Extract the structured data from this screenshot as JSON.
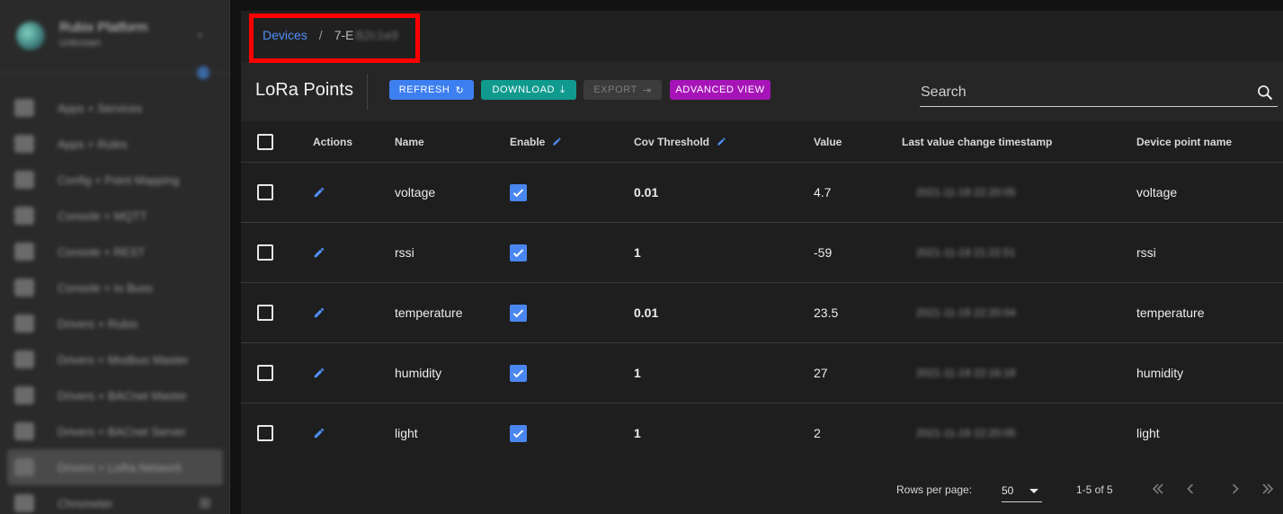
{
  "sidebar": {
    "brand_title": "Rubix Platform",
    "brand_sub": "Unknown",
    "items": [
      {
        "label": "Apps + Services"
      },
      {
        "label": "Apps + Rules"
      },
      {
        "label": "Config + Point Mapping"
      },
      {
        "label": "Console + MQTT"
      },
      {
        "label": "Console + REST"
      },
      {
        "label": "Console + Io Buss"
      },
      {
        "label": "Drivers + Rubix"
      },
      {
        "label": "Drivers + Modbus Master"
      },
      {
        "label": "Drivers + BACnet Master"
      },
      {
        "label": "Drivers + BACnet Server"
      },
      {
        "label": "Drivers + LoRa Network"
      },
      {
        "label": "Chrometer"
      }
    ]
  },
  "breadcrumb": {
    "link": "Devices",
    "separator": "/",
    "current": "7-E",
    "current_obscured": "B2c1e9"
  },
  "toolbar": {
    "title": "LoRa Points",
    "refresh": "REFRESH",
    "download": "DOWNLOAD",
    "export": "EXPORT",
    "advanced": "ADVANCED VIEW",
    "search_placeholder": "Search"
  },
  "table": {
    "headers": {
      "actions": "Actions",
      "name": "Name",
      "enable": "Enable",
      "cov": "Cov Threshold",
      "value": "Value",
      "timestamp": "Last value change timestamp",
      "device_point_name": "Device point name"
    },
    "rows": [
      {
        "name": "voltage",
        "enabled": true,
        "cov": "0.01",
        "value": "4.7",
        "timestamp": "2021-11-19 22:20:05",
        "dpn": "voltage"
      },
      {
        "name": "rssi",
        "enabled": true,
        "cov": "1",
        "value": "-59",
        "timestamp": "2021-11-19 21:22:51",
        "dpn": "rssi"
      },
      {
        "name": "temperature",
        "enabled": true,
        "cov": "0.01",
        "value": "23.5",
        "timestamp": "2021-11-19 22:20:04",
        "dpn": "temperature"
      },
      {
        "name": "humidity",
        "enabled": true,
        "cov": "1",
        "value": "27",
        "timestamp": "2021-11-19 22:16:18",
        "dpn": "humidity"
      },
      {
        "name": "light",
        "enabled": true,
        "cov": "1",
        "value": "2",
        "timestamp": "2021-11-19 22:20:05",
        "dpn": "light"
      }
    ]
  },
  "footer": {
    "rows_label": "Rows per page:",
    "rows_value": "50",
    "range": "1-5 of 5"
  },
  "colors": {
    "accent": "#4f8ff7",
    "refresh": "#3d7ff0",
    "download": "#109a8e",
    "advanced": "#a614b8",
    "highlight": "#ff0000"
  }
}
